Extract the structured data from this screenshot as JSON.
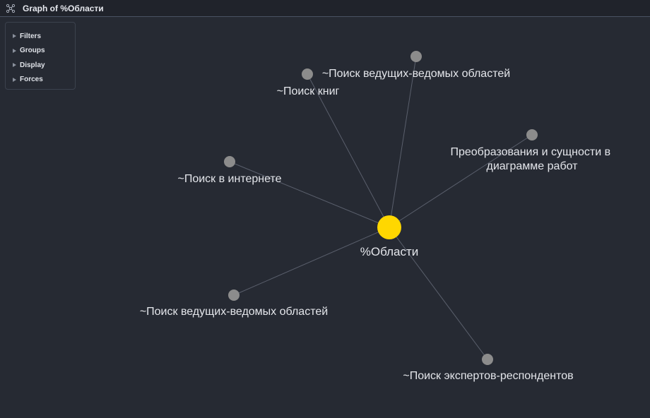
{
  "window": {
    "title": "Graph of %Области",
    "icon": "graph-icon"
  },
  "controls": {
    "items": [
      {
        "label": "Filters",
        "icon": "caret-right-icon"
      },
      {
        "label": "Groups",
        "icon": "caret-right-icon"
      },
      {
        "label": "Display",
        "icon": "caret-right-icon"
      },
      {
        "label": "Forces",
        "icon": "caret-right-icon"
      }
    ]
  },
  "graph": {
    "colors": {
      "center_node": "#ffd700",
      "node": "#8c8c8c",
      "edge": "#5a5f6c",
      "label": "#e4e6eb"
    },
    "center": {
      "label": "%Области"
    },
    "nodes": [
      {
        "label": "~Поиск книг"
      },
      {
        "label": "~Поиск ведущих-ведомых областей"
      },
      {
        "label": "Преобразования и сущности в диаграмме работ"
      },
      {
        "label": "~Поиск в интернете"
      },
      {
        "label": "~Поиск ведущих-ведомых областей"
      },
      {
        "label": "~Поиск экспертов-респондентов"
      }
    ]
  }
}
